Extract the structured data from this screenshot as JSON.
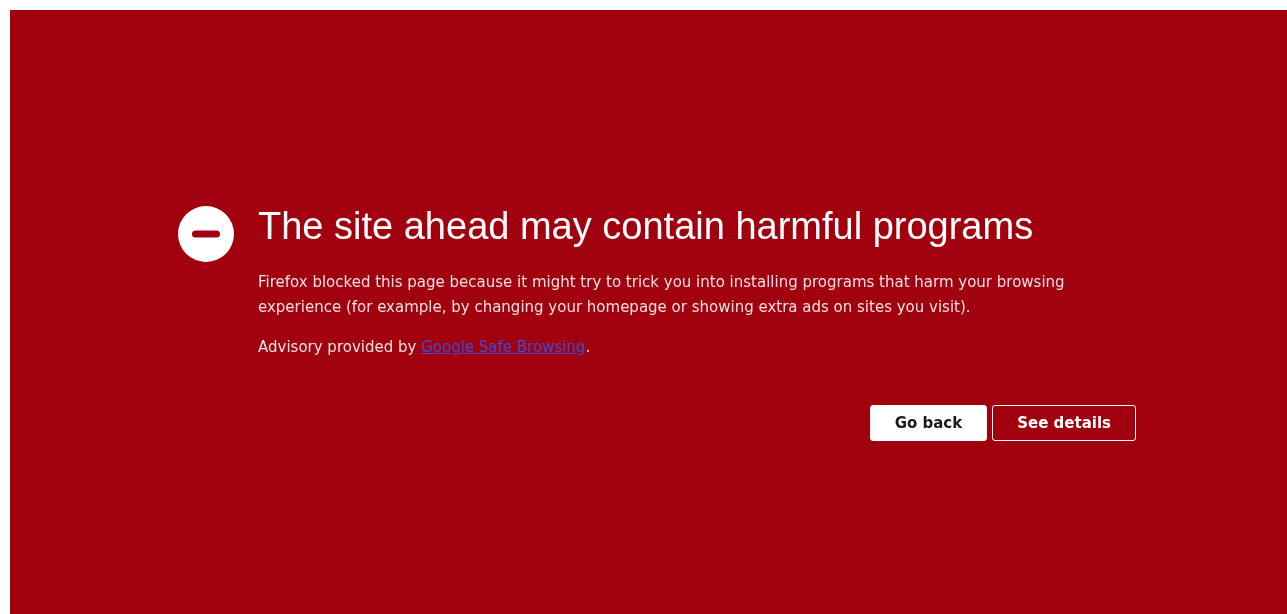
{
  "title": "The site ahead may contain harmful programs",
  "description": "Firefox blocked this page because it might try to trick you into installing programs that harm your browsing experience (for example, by changing your homepage or showing extra ads on sites you visit).",
  "advisory": {
    "prefix": "Advisory provided by ",
    "link": "Google Safe Browsing",
    "suffix": "."
  },
  "buttons": [
    {
      "label": "Go back",
      "kind": "primary"
    },
    {
      "label": "See details",
      "kind": "outline"
    }
  ]
}
